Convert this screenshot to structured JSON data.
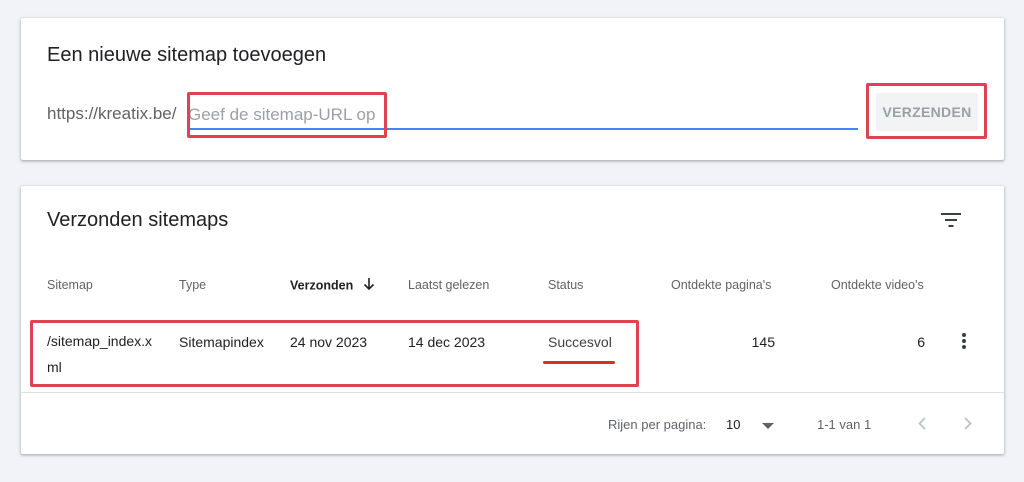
{
  "add_sitemap": {
    "title": "Een nieuwe sitemap toevoegen",
    "url_prefix": "https://kreatix.be/",
    "input_value": "",
    "input_placeholder": "Geef de sitemap-URL op",
    "submit_label": "VERZENDEN"
  },
  "submitted_sitemaps": {
    "title": "Verzonden sitemaps",
    "filter_icon": "filter-icon",
    "columns": [
      "Sitemap",
      "Type",
      "Verzonden",
      "Laatst gelezen",
      "Status",
      "Ontdekte pagina's",
      "Ontdekte video's"
    ],
    "sorted_column": "Verzonden",
    "rows": [
      {
        "sitemap_line1": "/sitemap_index.x",
        "sitemap_line2": "ml",
        "type": "Sitemapindex",
        "submitted": "24 nov 2023",
        "last_read": "14 dec 2023",
        "status": "Succesvol",
        "pages": "145",
        "videos": "6"
      }
    ],
    "pagination": {
      "rows_per_page_label": "Rijen per pagina:",
      "rows_per_page_value": "10",
      "range": "1-1 van 1"
    }
  },
  "colors": {
    "accent_blue": "#4285f4",
    "highlight_red": "#e0434f",
    "page_bg": "#f1f3f8"
  }
}
